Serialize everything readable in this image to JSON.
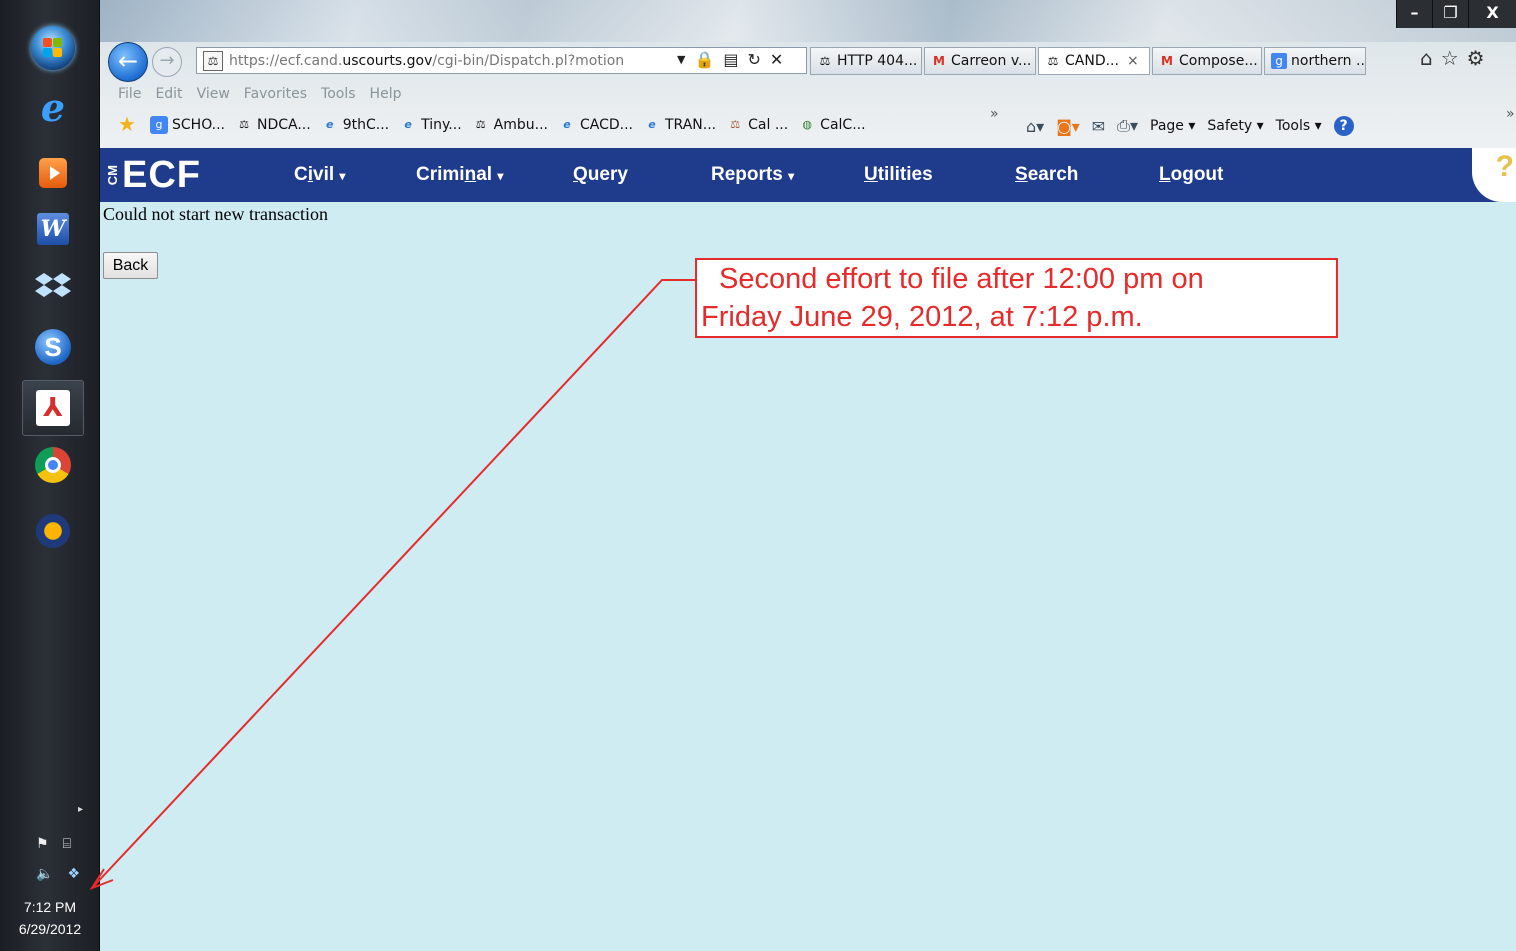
{
  "taskbar": {
    "icons": [
      "start-orb",
      "internet-explorer-icon",
      "media-player-icon",
      "word-icon",
      "dropbox-icon",
      "app-s-icon",
      "acrobat-icon",
      "chrome-icon",
      "audio-app-icon"
    ],
    "clock_time": "7:12 PM",
    "clock_date": "6/29/2012"
  },
  "browser": {
    "window_buttons": {
      "minimize": "–",
      "maximize": "❐",
      "close": "X"
    },
    "address": {
      "prefix": "https://ecf.cand.",
      "domain": "uscourts.gov",
      "suffix": "/cgi-bin/Dispatch.pl?motion"
    },
    "tabs": [
      {
        "label": "HTTP 404...",
        "icon": "scales-icon",
        "active": false
      },
      {
        "label": "Carreon v...",
        "icon": "gmail-icon",
        "active": false
      },
      {
        "label": "CAND...",
        "icon": "scales-icon",
        "active": true
      },
      {
        "label": "Compose...",
        "icon": "gmail-icon",
        "active": false
      },
      {
        "label": "northern ...",
        "icon": "google-icon",
        "active": false
      }
    ],
    "menu": [
      "File",
      "Edit",
      "View",
      "Favorites",
      "Tools",
      "Help"
    ],
    "favorites": [
      {
        "label": "SCHO...",
        "icon": "google-icon"
      },
      {
        "label": "NDCA...",
        "icon": "scales-icon"
      },
      {
        "label": "9thC...",
        "icon": "ie-page-icon"
      },
      {
        "label": "Tiny...",
        "icon": "ie-page-icon"
      },
      {
        "label": "Ambu...",
        "icon": "scales-icon"
      },
      {
        "label": "CACD...",
        "icon": "ie-page-icon"
      },
      {
        "label": "TRAN...",
        "icon": "ie-page-icon"
      },
      {
        "label": "Cal ...",
        "icon": "scales-icon"
      },
      {
        "label": "CalC...",
        "icon": "globe-icon"
      }
    ],
    "command_bar": {
      "page": "Page",
      "safety": "Safety",
      "tools": "Tools"
    }
  },
  "ecf": {
    "logo_small": "CM",
    "logo_big": "ECF",
    "menu": [
      {
        "pre": "C",
        "u": "i",
        "post": "vil",
        "dropdown": true
      },
      {
        "pre": "Crimi",
        "u": "n",
        "post": "al",
        "dropdown": true
      },
      {
        "pre": "",
        "u": "Q",
        "post": "uery",
        "dropdown": false
      },
      {
        "pre": "Reports",
        "u": "",
        "post": "",
        "dropdown": true
      },
      {
        "pre": "",
        "u": "U",
        "post": "tilities",
        "dropdown": false
      },
      {
        "pre": "",
        "u": "S",
        "post": "earch",
        "dropdown": false
      },
      {
        "pre": "",
        "u": "L",
        "post": "ogout",
        "dropdown": false
      }
    ],
    "help": "?"
  },
  "content": {
    "message": "Could not start new transaction",
    "back_button": "Back"
  },
  "annotation": {
    "line1": "Second effort to file after 12:00 pm on",
    "line2": "Friday June 29, 2012, at 7:12 p.m.",
    "color": "#e52b2b"
  },
  "colors": {
    "ecf_nav": "#1f3b8c",
    "content_bg": "#cfecf3"
  }
}
